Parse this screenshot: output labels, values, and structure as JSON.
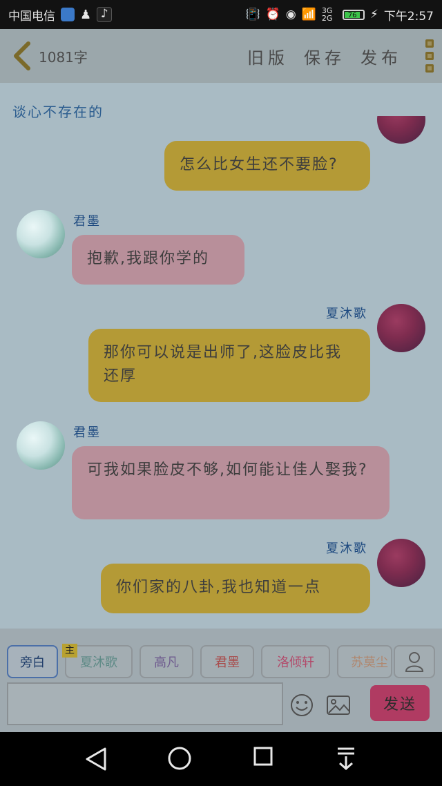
{
  "statusbar": {
    "carrier": "中国电信",
    "network": "3G 2G",
    "battery": "76",
    "time": "下午2:57"
  },
  "toolbar": {
    "word_count": "1081字",
    "old_version": "旧版",
    "save": "保存",
    "publish": "发布"
  },
  "chat": {
    "title": "谈心不存在的",
    "messages": [
      {
        "side": "right",
        "speaker": "",
        "text": "怎么比女生还不要脸?"
      },
      {
        "side": "left",
        "speaker": "君墨",
        "text": "抱歉,我跟你学的"
      },
      {
        "side": "right",
        "speaker": "夏沐歌",
        "text": "那你可以说是出师了,这脸皮比我还厚"
      },
      {
        "side": "left",
        "speaker": "君墨",
        "text": "可我如果脸皮不够,如何能让佳人娶我?"
      },
      {
        "side": "right",
        "speaker": "夏沐歌",
        "text": "你们家的八卦,我也知道一点"
      }
    ]
  },
  "roles": {
    "host_badge": "主",
    "items": [
      {
        "label": "旁白",
        "color": "#1f3d6a"
      },
      {
        "label": "夏沐歌",
        "color": "#5d8a86"
      },
      {
        "label": "高凡",
        "color": "#6e5a8e"
      },
      {
        "label": "君墨",
        "color": "#a84c4c"
      },
      {
        "label": "洛倾轩",
        "color": "#b24a6a"
      },
      {
        "label": "苏莫尘",
        "color": "#b0876e"
      }
    ]
  },
  "composer": {
    "input_value": "",
    "send_label": "发送"
  },
  "icons": {
    "back": "chevron-left-icon",
    "menu": "menu-icon",
    "emoji": "emoji-icon",
    "image": "image-icon",
    "person": "person-icon"
  },
  "colors": {
    "bubble_mine": "#b49a36",
    "bubble_other": "#b88f9a",
    "name_text": "#1e4a80",
    "send_button": "#b03b62"
  }
}
